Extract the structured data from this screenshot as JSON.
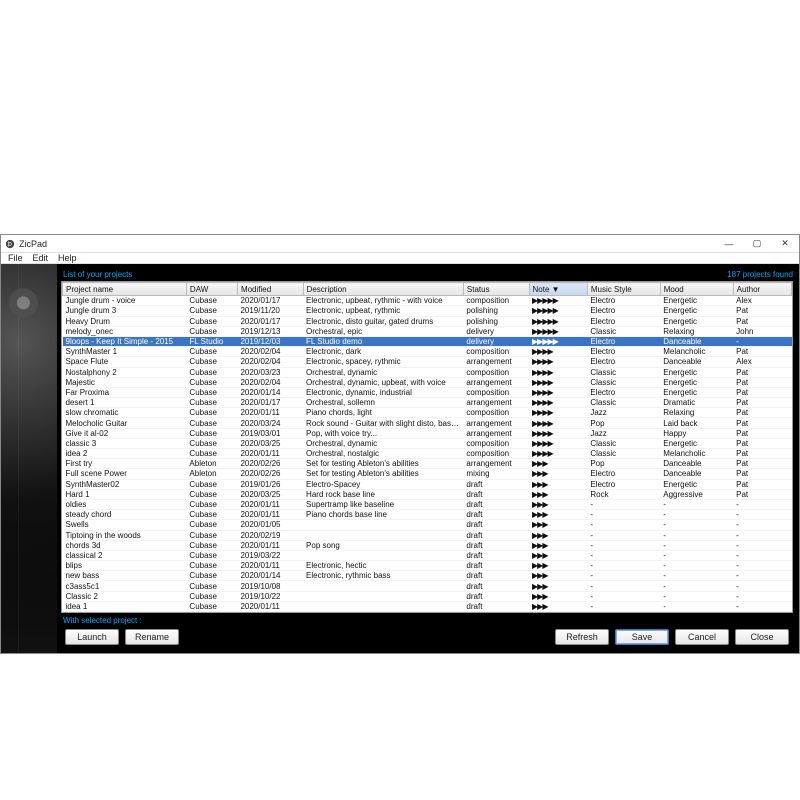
{
  "app": {
    "title": "ZicPad"
  },
  "menu": {
    "file": "File",
    "edit": "Edit",
    "help": "Help"
  },
  "window_controls": {
    "min": "—",
    "max": "▢",
    "close": "✕"
  },
  "header": {
    "left": "List of your projects",
    "right": "187 projects found"
  },
  "columns": {
    "name": "Project name",
    "daw": "DAW",
    "modified": "Modified",
    "description": "Description",
    "status": "Status",
    "note": "Note",
    "style": "Music Style",
    "mood": "Mood",
    "author": "Author"
  },
  "sort_indicator": "▼",
  "footer": {
    "label": "With selected project :"
  },
  "buttons": {
    "launch": "Launch",
    "rename": "Rename",
    "refresh": "Refresh",
    "save": "Save",
    "cancel": "Cancel",
    "close": "Close"
  },
  "selected_index": 4,
  "rows": [
    {
      "name": "Jungle drum - voice",
      "daw": "Cubase",
      "modified": "2020/01/17",
      "description": "Electronic, upbeat, rythmic - with voice",
      "status": "composition",
      "note": 5,
      "style": "Electro",
      "mood": "Energetic",
      "author": "Alex"
    },
    {
      "name": "Jungle drum 3",
      "daw": "Cubase",
      "modified": "2019/11/20",
      "description": "Electronic, upbeat, rythmic",
      "status": "polishing",
      "note": 5,
      "style": "Electro",
      "mood": "Energetic",
      "author": "Pat"
    },
    {
      "name": "Heavy Drum",
      "daw": "Cubase",
      "modified": "2020/01/17",
      "description": "Electronic, disto guitar, gated drums",
      "status": "polishing",
      "note": 5,
      "style": "Electro",
      "mood": "Energetic",
      "author": "Pat"
    },
    {
      "name": "melody_onec",
      "daw": "Cubase",
      "modified": "2019/12/13",
      "description": "Orchestral, epic",
      "status": "delivery",
      "note": 5,
      "style": "Classic",
      "mood": "Relaxing",
      "author": "John"
    },
    {
      "name": "9loops - Keep It Simple - 2015",
      "daw": "FL Studio",
      "modified": "2019/12/03",
      "description": "FL Studio demo",
      "status": "delivery",
      "note": 5,
      "style": "Electro",
      "mood": "Danceable",
      "author": "-"
    },
    {
      "name": "SynthMaster 1",
      "daw": "Cubase",
      "modified": "2020/02/04",
      "description": "Electronic, dark",
      "status": "composition",
      "note": 4,
      "style": "Electro",
      "mood": "Melancholic",
      "author": "Pat"
    },
    {
      "name": "Space Flute",
      "daw": "Cubase",
      "modified": "2020/02/04",
      "description": "Electronic, spacey, rythmic",
      "status": "arrangement",
      "note": 4,
      "style": "Electro",
      "mood": "Danceable",
      "author": "Alex"
    },
    {
      "name": "Nostalphony 2",
      "daw": "Cubase",
      "modified": "2020/03/23",
      "description": "Orchestral, dynamic",
      "status": "composition",
      "note": 4,
      "style": "Classic",
      "mood": "Energetic",
      "author": "Pat"
    },
    {
      "name": "Majestic",
      "daw": "Cubase",
      "modified": "2020/02/04",
      "description": "Orchestral, dynamic, upbeat, with voice",
      "status": "arrangement",
      "note": 4,
      "style": "Classic",
      "mood": "Energetic",
      "author": "Pat"
    },
    {
      "name": "Far Proxima",
      "daw": "Cubase",
      "modified": "2020/01/14",
      "description": "Electronic, dynamic, industrial",
      "status": "composition",
      "note": 4,
      "style": "Electro",
      "mood": "Energetic",
      "author": "Pat"
    },
    {
      "name": "desert 1",
      "daw": "Cubase",
      "modified": "2020/01/17",
      "description": "Orchestral, sollemn",
      "status": "arrangement",
      "note": 4,
      "style": "Classic",
      "mood": "Dramatic",
      "author": "Pat"
    },
    {
      "name": "slow chromatic",
      "daw": "Cubase",
      "modified": "2020/01/11",
      "description": "Piano chords, light",
      "status": "composition",
      "note": 4,
      "style": "Jazz",
      "mood": "Relaxing",
      "author": "Pat"
    },
    {
      "name": "Melocholic Guitar",
      "daw": "Cubase",
      "modified": "2020/03/24",
      "description": "Rock sound - Guitar with slight disto, bass, dru...",
      "status": "arrangement",
      "note": 4,
      "style": "Pop",
      "mood": "Laid back",
      "author": "Pat"
    },
    {
      "name": "Give it al-02",
      "daw": "Cubase",
      "modified": "2019/03/01",
      "description": "Pop, with voice try...",
      "status": "arrangement",
      "note": 4,
      "style": "Jazz",
      "mood": "Happy",
      "author": "Pat"
    },
    {
      "name": "classic 3",
      "daw": "Cubase",
      "modified": "2020/03/25",
      "description": "Orchestral, dynamic",
      "status": "composition",
      "note": 4,
      "style": "Classic",
      "mood": "Energetic",
      "author": "Pat"
    },
    {
      "name": "idea 2",
      "daw": "Cubase",
      "modified": "2020/01/11",
      "description": "Orchestral, nostalgic",
      "status": "composition",
      "note": 4,
      "style": "Classic",
      "mood": "Melancholic",
      "author": "Pat"
    },
    {
      "name": "First try",
      "daw": "Ableton",
      "modified": "2020/02/26",
      "description": "Set for testing Ableton's abilities",
      "status": "arrangement",
      "note": 3,
      "style": "Pop",
      "mood": "Danceable",
      "author": "Pat"
    },
    {
      "name": "Full scene Power",
      "daw": "Ableton",
      "modified": "2020/02/26",
      "description": "Set for testing Ableton's abilities",
      "status": "mixing",
      "note": 3,
      "style": "Electro",
      "mood": "Danceable",
      "author": "Pat"
    },
    {
      "name": "SynthMaster02",
      "daw": "Cubase",
      "modified": "2019/01/26",
      "description": "Electro-Spacey",
      "status": "draft",
      "note": 3,
      "style": "Electro",
      "mood": "Energetic",
      "author": "Pat"
    },
    {
      "name": "Hard 1",
      "daw": "Cubase",
      "modified": "2020/03/25",
      "description": "Hard rock base line",
      "status": "draft",
      "note": 3,
      "style": "Rock",
      "mood": "Aggressive",
      "author": "Pat"
    },
    {
      "name": "oldies",
      "daw": "Cubase",
      "modified": "2020/01/11",
      "description": "Supertramp like baseline",
      "status": "draft",
      "note": 3,
      "style": "-",
      "mood": "-",
      "author": "-"
    },
    {
      "name": "steady chord",
      "daw": "Cubase",
      "modified": "2020/01/11",
      "description": "Piano chords base line",
      "status": "draft",
      "note": 3,
      "style": "-",
      "mood": "-",
      "author": "-"
    },
    {
      "name": "Swells",
      "daw": "Cubase",
      "modified": "2020/01/05",
      "description": "",
      "status": "draft",
      "note": 3,
      "style": "-",
      "mood": "-",
      "author": "-"
    },
    {
      "name": "Tiptoing in the woods",
      "daw": "Cubase",
      "modified": "2020/02/19",
      "description": "",
      "status": "draft",
      "note": 3,
      "style": "-",
      "mood": "-",
      "author": "-"
    },
    {
      "name": "chords 3d",
      "daw": "Cubase",
      "modified": "2020/01/11",
      "description": "Pop song",
      "status": "draft",
      "note": 3,
      "style": "-",
      "mood": "-",
      "author": "-"
    },
    {
      "name": "classical 2",
      "daw": "Cubase",
      "modified": "2019/03/22",
      "description": "",
      "status": "draft",
      "note": 3,
      "style": "-",
      "mood": "-",
      "author": "-"
    },
    {
      "name": "blips",
      "daw": "Cubase",
      "modified": "2020/01/11",
      "description": "Electronic, hectic",
      "status": "draft",
      "note": 3,
      "style": "-",
      "mood": "-",
      "author": "-"
    },
    {
      "name": "new bass",
      "daw": "Cubase",
      "modified": "2020/01/14",
      "description": "Electronic, rythmic bass",
      "status": "draft",
      "note": 3,
      "style": "-",
      "mood": "-",
      "author": "-"
    },
    {
      "name": "c3ass5c1",
      "daw": "Cubase",
      "modified": "2019/10/08",
      "description": "",
      "status": "draft",
      "note": 3,
      "style": "-",
      "mood": "-",
      "author": "-"
    },
    {
      "name": "Classic 2",
      "daw": "Cubase",
      "modified": "2019/10/22",
      "description": "",
      "status": "draft",
      "note": 3,
      "style": "-",
      "mood": "-",
      "author": "-"
    },
    {
      "name": "idea 1",
      "daw": "Cubase",
      "modified": "2020/01/11",
      "description": "",
      "status": "draft",
      "note": 3,
      "style": "-",
      "mood": "-",
      "author": "-"
    }
  ]
}
